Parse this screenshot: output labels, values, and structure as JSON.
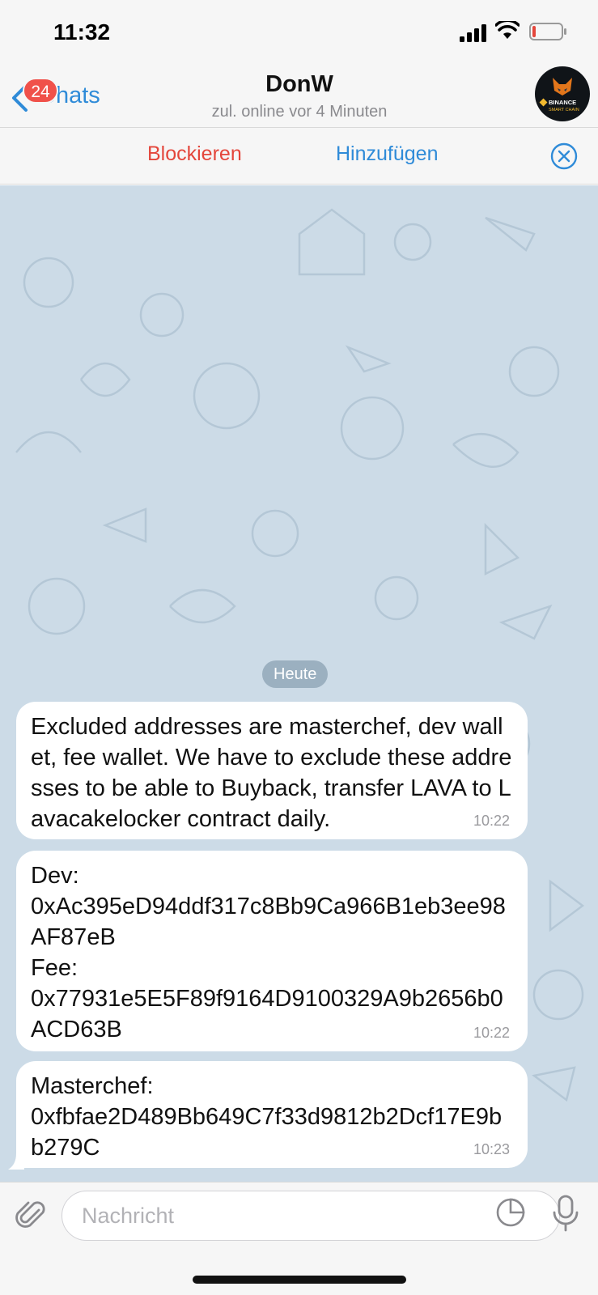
{
  "status_bar": {
    "time": "11:32"
  },
  "header": {
    "back_label": "Chats",
    "unread_badge": "24",
    "title": "DonW",
    "subtitle": "zul. online vor 4 Minuten",
    "avatar_text": "BINANCE",
    "avatar_subtext": "SMART CHAIN"
  },
  "action_bar": {
    "block_label": "Blockieren",
    "add_label": "Hinzufügen"
  },
  "chat": {
    "date_label": "Heute",
    "messages": [
      {
        "text": "Excluded addresses are masterchef, dev wallet, fee wallet. We have to exclude these addresses to be able to Buyback, transfer LAVA to Lavacakelocker contract daily.",
        "time": "10:22"
      },
      {
        "line1": "Dev:",
        "line2": "0xAc395eD94ddf317c8Bb9Ca966B1eb3ee98AF87eB",
        "line3": "Fee:",
        "line4": "0x77931e5E5F89f9164D9100329A9b2656b0ACD63B",
        "time": "10:22"
      },
      {
        "line1": "Masterchef:",
        "line2": "0xfbfae2D489Bb649C7f33d9812b2Dcf17E9bb279C",
        "time": "10:23"
      }
    ]
  },
  "input": {
    "placeholder": "Nachricht"
  },
  "colors": {
    "accent": "#2f8bd8",
    "danger": "#e4463b",
    "badge": "#f0514a",
    "chat_background": "#ccdbe7"
  },
  "icons": [
    "signal-icon",
    "wifi-icon",
    "battery-icon",
    "back-chevron-icon",
    "close-circle-icon",
    "attach-icon",
    "sticker-icon",
    "microphone-icon"
  ]
}
